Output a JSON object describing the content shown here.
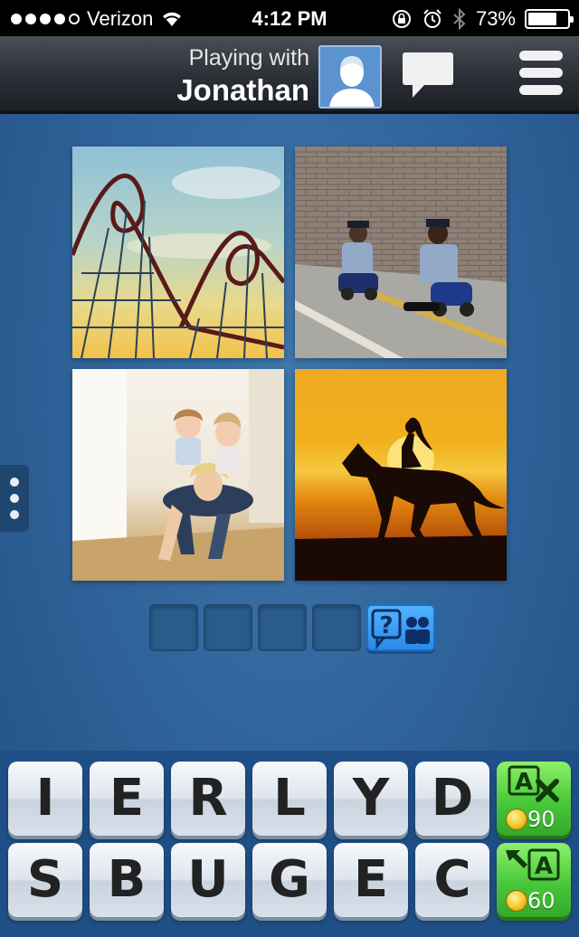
{
  "status_bar": {
    "carrier": "Verizon",
    "time": "4:12 PM",
    "battery_percent": "73%",
    "battery_level": 0.73,
    "signal_dots_filled": 4,
    "signal_dots_total": 5
  },
  "header": {
    "playing_with_label": "Playing with",
    "opponent_name": "Jonathan",
    "icons": [
      "avatar-placeholder",
      "chat-bubble",
      "menu-hamburger"
    ]
  },
  "puzzle": {
    "images": [
      {
        "subject": "roller-coaster"
      },
      {
        "subject": "police-officers-on-toy-scooters"
      },
      {
        "subject": "kids-riding-on-mother"
      },
      {
        "subject": "horse-rider-silhouette-at-sunset"
      }
    ],
    "answer_slots": [
      "",
      "",
      "",
      ""
    ]
  },
  "keyboard": {
    "row1": [
      "I",
      "E",
      "R",
      "L",
      "Y",
      "D"
    ],
    "row2": [
      "S",
      "B",
      "U",
      "G",
      "E",
      "C"
    ],
    "powerups": [
      {
        "name": "remove-letters",
        "cost": "90"
      },
      {
        "name": "reveal-letter",
        "cost": "60"
      }
    ]
  },
  "colors": {
    "background": "#2e6298",
    "key_face": "#dde4ec",
    "powerup_green": "#48c83a",
    "ask_button_blue": "#2a8ae6"
  }
}
